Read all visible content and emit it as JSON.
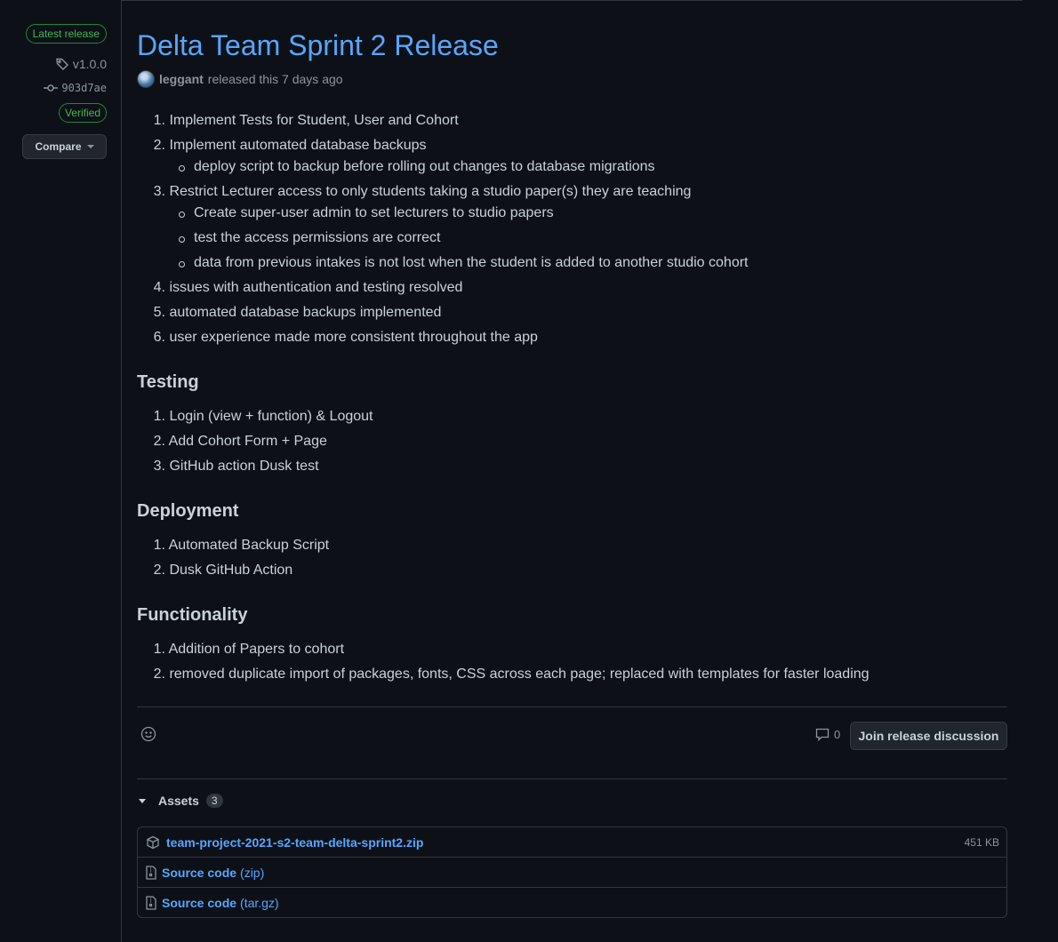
{
  "sidebar": {
    "latest_badge": "Latest release",
    "tag": "v1.0.0",
    "commit": "903d7ae",
    "verified_badge": "Verified",
    "compare_label": "Compare"
  },
  "release": {
    "title": "Delta Team Sprint 2 Release",
    "author": "leggant",
    "released_text": "released this 7 days ago"
  },
  "notes": {
    "intro": [
      {
        "num": "1.",
        "text": "Implement Tests for Student, User and Cohort",
        "subs": []
      },
      {
        "num": "2.",
        "text": "Implement automated database backups",
        "subs": [
          "deploy script to backup before rolling out changes to database migrations"
        ]
      },
      {
        "num": "3.",
        "text": "Restrict Lecturer access to only students taking a studio paper(s) they are teaching",
        "subs": [
          "Create super-user admin to set lecturers to studio papers",
          "test the access permissions are correct",
          "data from previous intakes is not lost when the student is added to another studio cohort"
        ]
      },
      {
        "num": "4.",
        "text": "issues with authentication and testing resolved",
        "subs": []
      },
      {
        "num": "5.",
        "text": "automated database backups implemented",
        "subs": []
      },
      {
        "num": "6.",
        "text": "user experience made more consistent throughout the app",
        "subs": []
      }
    ],
    "testing": {
      "heading": "Testing",
      "items": [
        "Login (view + function) & Logout",
        "Add Cohort Form + Page",
        "GitHub action Dusk test"
      ]
    },
    "deployment": {
      "heading": "Deployment",
      "items": [
        "Automated Backup Script",
        "Dusk GitHub Action"
      ]
    },
    "functionality": {
      "heading": "Functionality",
      "items": [
        "Addition of Papers to cohort",
        "removed duplicate import of packages, fonts, CSS across each page; replaced with templates for faster loading"
      ]
    }
  },
  "footer": {
    "comment_count": "0",
    "join_label": "Join release discussion"
  },
  "assets": {
    "label": "Assets",
    "count": "3",
    "items": [
      {
        "name": "team-project-2021-s2-team-delta-sprint2.zip",
        "ext": "",
        "size": "451 KB"
      },
      {
        "name": "Source code",
        "ext": "(zip)",
        "size": ""
      },
      {
        "name": "Source code",
        "ext": "(tar.gz)",
        "size": ""
      }
    ]
  },
  "colors": {
    "background": "#0d1117",
    "link": "#58a6ff",
    "success": "#3fb950",
    "border": "#30363d"
  }
}
